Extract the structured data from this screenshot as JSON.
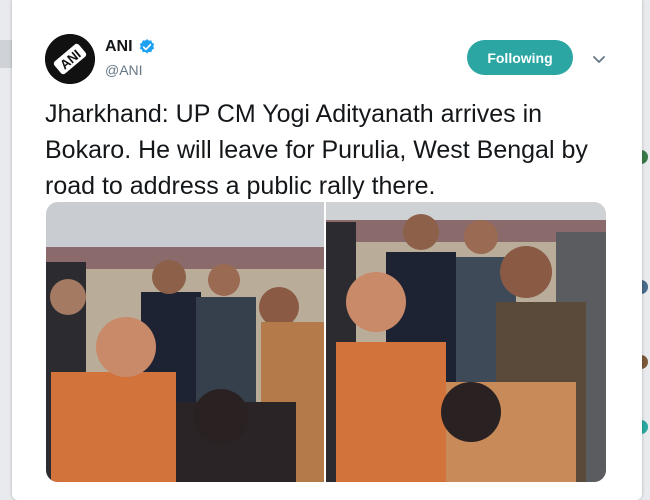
{
  "tweet": {
    "author_name": "ANI",
    "author_handle": "@ANI",
    "verified": true,
    "follow_label": "Following",
    "text": "Jharkhand: UP CM Yogi Adityanath arrives in Bokaro. He will leave for Purulia, West Bengal by road to address a public rally there.",
    "media_count": 2
  },
  "colors": {
    "follow_button": "#2ba6a3",
    "verified_badge": "#1da1f2",
    "handle_text": "#657786"
  },
  "icons": {
    "verified": "verified-badge-icon",
    "caret": "chevron-down-icon",
    "avatar": "ani-logo"
  }
}
